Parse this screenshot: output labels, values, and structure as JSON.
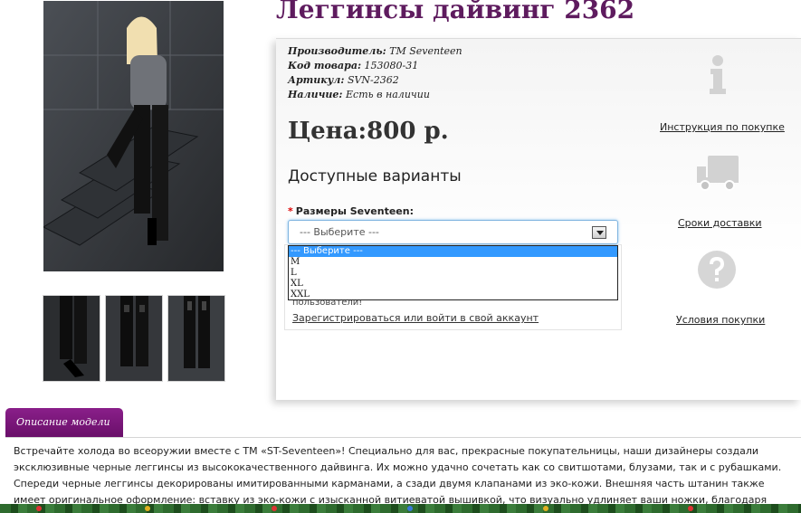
{
  "product": {
    "title": "Леггинсы дайвинг 2362",
    "meta": [
      {
        "key": "Производитель:",
        "value": "TM Seventeen"
      },
      {
        "key": "Код товара:",
        "value": "153080-31"
      },
      {
        "key": "Артикул:",
        "value": "SVN-2362"
      },
      {
        "key": "Наличие:",
        "value": "Есть в наличии"
      }
    ],
    "price": "Цена:800 р."
  },
  "options": {
    "heading": "Доступные варианты",
    "size_label": "Размеры Seventeen:",
    "required_mark": "*",
    "selected": "--- Выберите ---",
    "dropdown": [
      "--- Выберите ---",
      "M",
      "L",
      "XL",
      "XXL"
    ],
    "partial_text": "пользователи!",
    "register_link": "Зарегистрироваться или войти в свой аккаунт"
  },
  "sidebar": {
    "links": [
      {
        "label": "Инструкция по покупке",
        "icon": "info-icon"
      },
      {
        "label": "Сроки доставки",
        "icon": "delivery-truck-icon"
      },
      {
        "label": "Условия покупки",
        "icon": "question-icon"
      }
    ]
  },
  "description": {
    "tab": "Описание модели",
    "text": "Встречайте холода во всеоружии вместе с ТМ «ST-Seventeen»! Специально для вас, прекрасные покупательницы, наши дизайнеры создали эксклюзивные черные леггинсы из высококачественного дайвинга. Их можно удачно сочетать как со свитшотами, блузами, так и с рубашками. Спереди черные леггинсы декорированы имитированными карманами, а сзади двумя клапанами из эко-кожи. Внешняя часть штанин также имеет оригинальное оформление: вставку из эко-кожи с изысканной витиеватой вышивкой, что визуально удлиняет ваши ножки, благодаря чему образ становится кокетливым и игривым."
  },
  "colors": {
    "title": "#5e1b5e",
    "tab": "#7a177a",
    "dropdown_highlight": "#3399ff"
  }
}
